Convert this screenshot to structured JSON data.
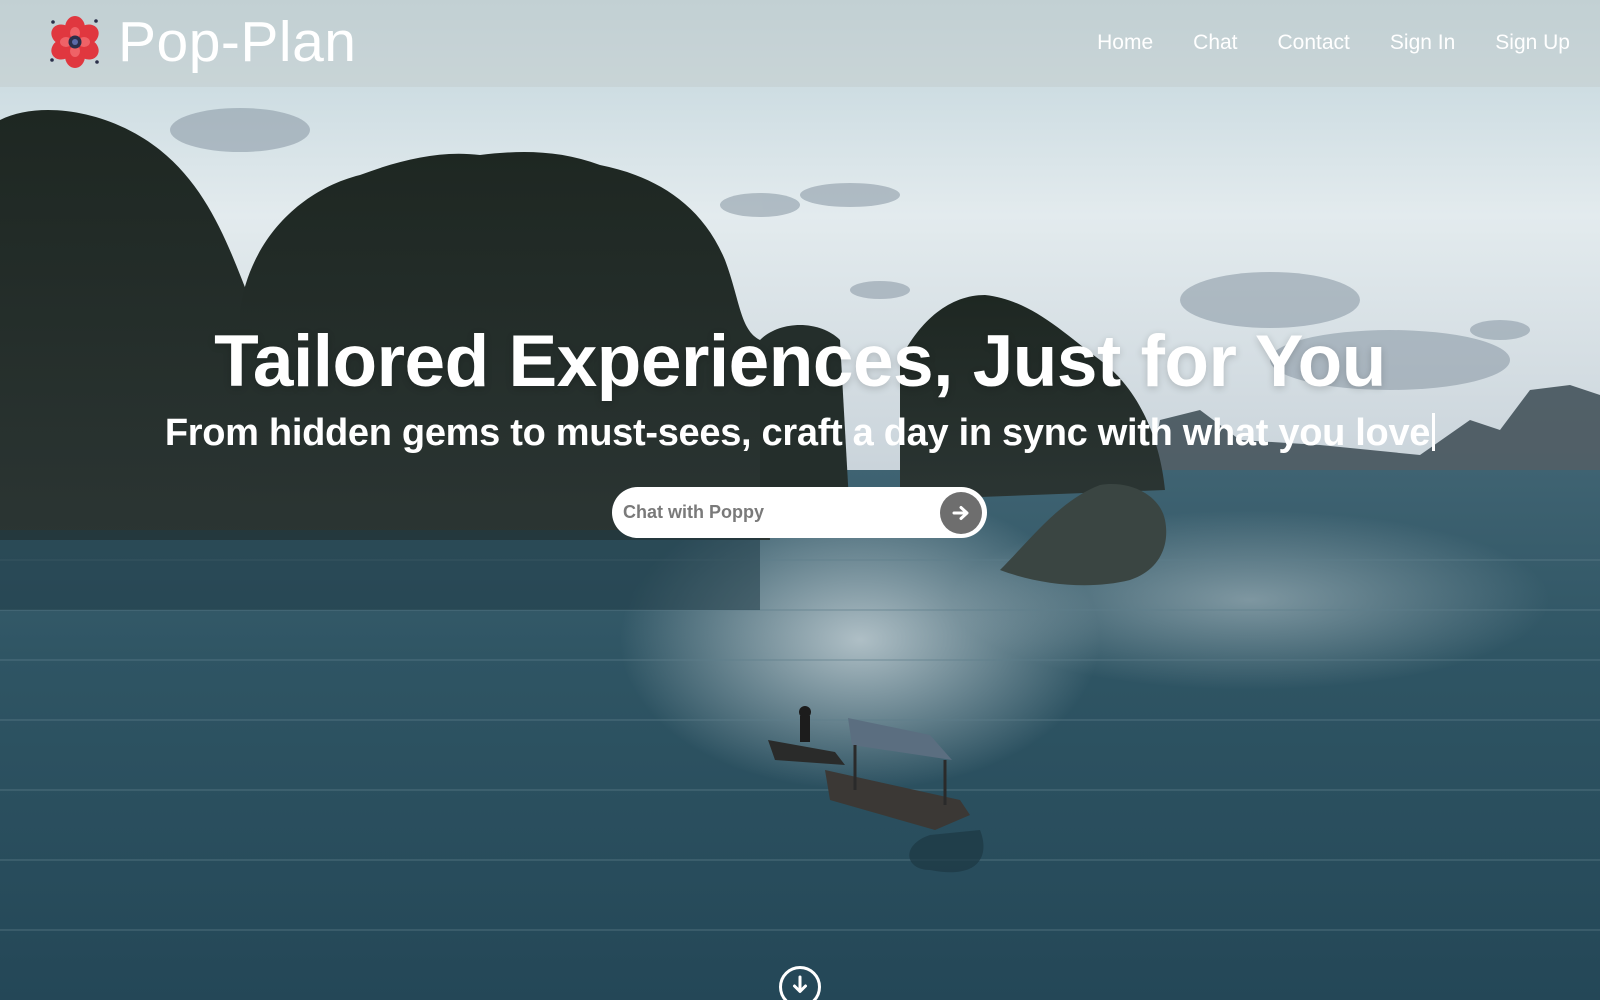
{
  "brand": {
    "name": "Pop-Plan",
    "logo_icon": "poppy-flower-icon"
  },
  "nav": {
    "items": [
      {
        "label": "Home"
      },
      {
        "label": "Chat"
      },
      {
        "label": "Contact"
      },
      {
        "label": "Sign In"
      },
      {
        "label": "Sign Up"
      }
    ]
  },
  "hero": {
    "title": "Tailored Experiences, Just for You",
    "subtitle": "From hidden gems to must-sees, craft a day in sync with what you love",
    "chat": {
      "placeholder": "Chat with Poppy",
      "send_icon": "arrow-right-icon"
    },
    "scroll_icon": "arrow-down-circle-icon"
  },
  "colors": {
    "navbar_bg": "#c4cdce",
    "text": "#ffffff",
    "send_button": "#6e6e6e",
    "logo_red": "#e0373f"
  }
}
